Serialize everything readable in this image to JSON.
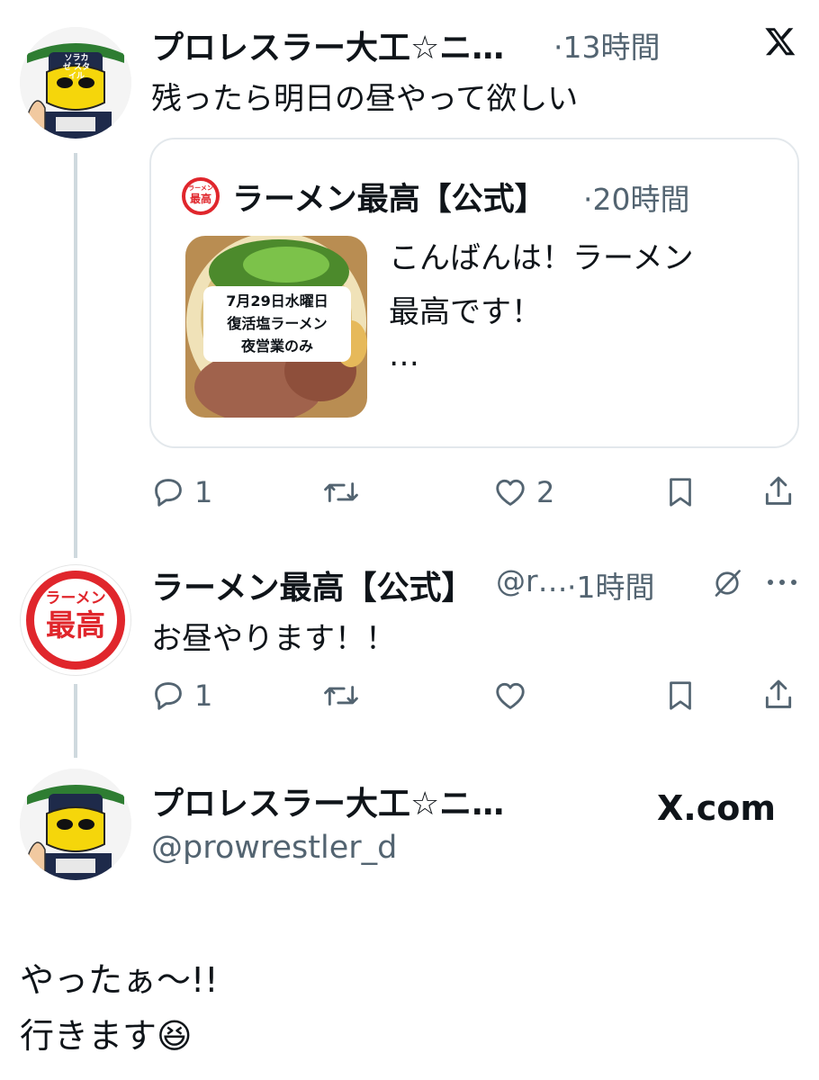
{
  "tweet1": {
    "display_name": "プロレスラー大工☆ニ…",
    "time": "·13時間",
    "text": "残ったら明日の昼やって欲しい",
    "avatar_text": "ソラカゼ スタイル",
    "actions": {
      "reply_count": "1",
      "retweet_count": "",
      "like_count": "2"
    }
  },
  "quote": {
    "display_name": "ラーメン最高【公式】",
    "time": "·20時間",
    "text_line1": "こんばんは！ラーメン",
    "text_line2": "最高です！",
    "text_more": "…",
    "thumb_lines": [
      "7月29日水曜日",
      "復活塩ラーメン",
      "夜営業のみ"
    ],
    "badge_top": "ラーメン",
    "badge_bottom": "最高"
  },
  "tweet2": {
    "display_name": "ラーメン最高【公式】",
    "handle": "@r…",
    "time": "·1時間",
    "text": "お昼やります！！",
    "avatar_top": "ラーメン",
    "avatar_bottom": "最高",
    "actions": {
      "reply_count": "1",
      "retweet_count": "",
      "like_count": ""
    }
  },
  "tweet3": {
    "display_name": "プロレスラー大工☆ニ…",
    "handle": "@prowrestler_d",
    "brand": "X.com",
    "text_line1": "やったぁ〜!!",
    "text_line2": "行きます😆"
  },
  "colors": {
    "text": "#0f1419",
    "muted": "#536471",
    "line": "#cfd9de",
    "ramen_red": "#e0262c"
  }
}
